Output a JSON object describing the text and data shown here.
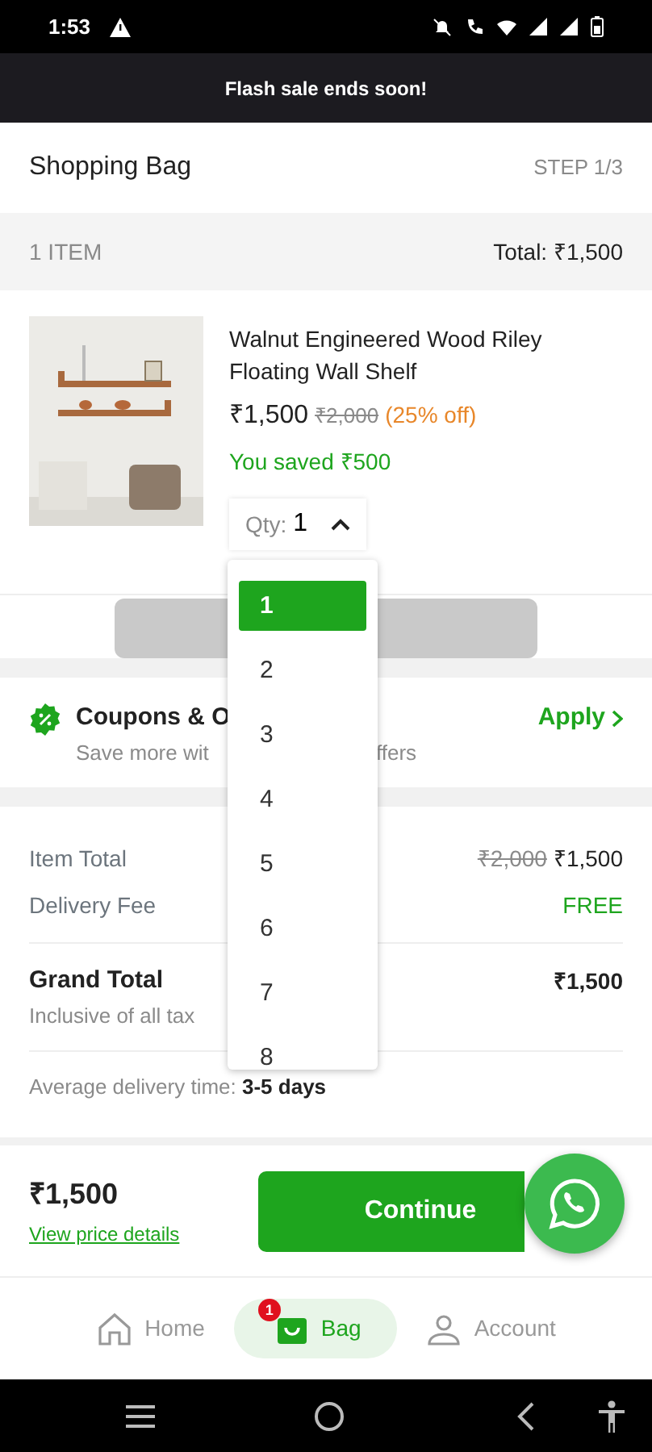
{
  "status_bar": {
    "time": "1:53"
  },
  "banner": {
    "text": "Flash sale ends soon!"
  },
  "header": {
    "title": "Shopping Bag",
    "step": "STEP 1/3"
  },
  "count_bar": {
    "count": "1 ITEM",
    "total": "Total: ₹1,500"
  },
  "product": {
    "kind": "picture",
    "name": "Walnut Engineered Wood Riley Floating Wall Shelf",
    "price": "₹1,500",
    "mrp": "₹2,000",
    "discount": "(25% off)",
    "saved": "You saved ₹500",
    "qty_label": "Qty:",
    "qty_value": "1",
    "expanded": true
  },
  "qty_options": [
    {
      "label": "1",
      "selected": true
    },
    {
      "label": "2",
      "selected": false
    },
    {
      "label": "3",
      "selected": false
    },
    {
      "label": "4",
      "selected": false
    },
    {
      "label": "5",
      "selected": false
    },
    {
      "label": "6",
      "selected": false
    },
    {
      "label": "7",
      "selected": false
    },
    {
      "label": "8",
      "selected": false
    }
  ],
  "coupons": {
    "title": "Coupons & O",
    "subtitle_parts": [
      "Save more wit",
      "ffers"
    ],
    "action": "Apply"
  },
  "price_details": {
    "item_total_label": "Item Total",
    "item_total_mrp": "₹2,000",
    "item_total": "₹1,500",
    "delivery_label": "Delivery Fee",
    "delivery_value": "FREE",
    "grand_label": "Grand Total",
    "grand_value": "₹1,500",
    "grand_note": "Inclusive of all tax",
    "delivery_time": "Average delivery time: **3-5 days**"
  },
  "footer": {
    "price": "₹1,500",
    "link": "View price details",
    "button": "Continue"
  },
  "bottom_nav": [
    {
      "label": "Home",
      "selected": false
    },
    {
      "label": "Bag",
      "selected": true,
      "badge": "1"
    },
    {
      "label": "Account",
      "selected": false
    }
  ]
}
